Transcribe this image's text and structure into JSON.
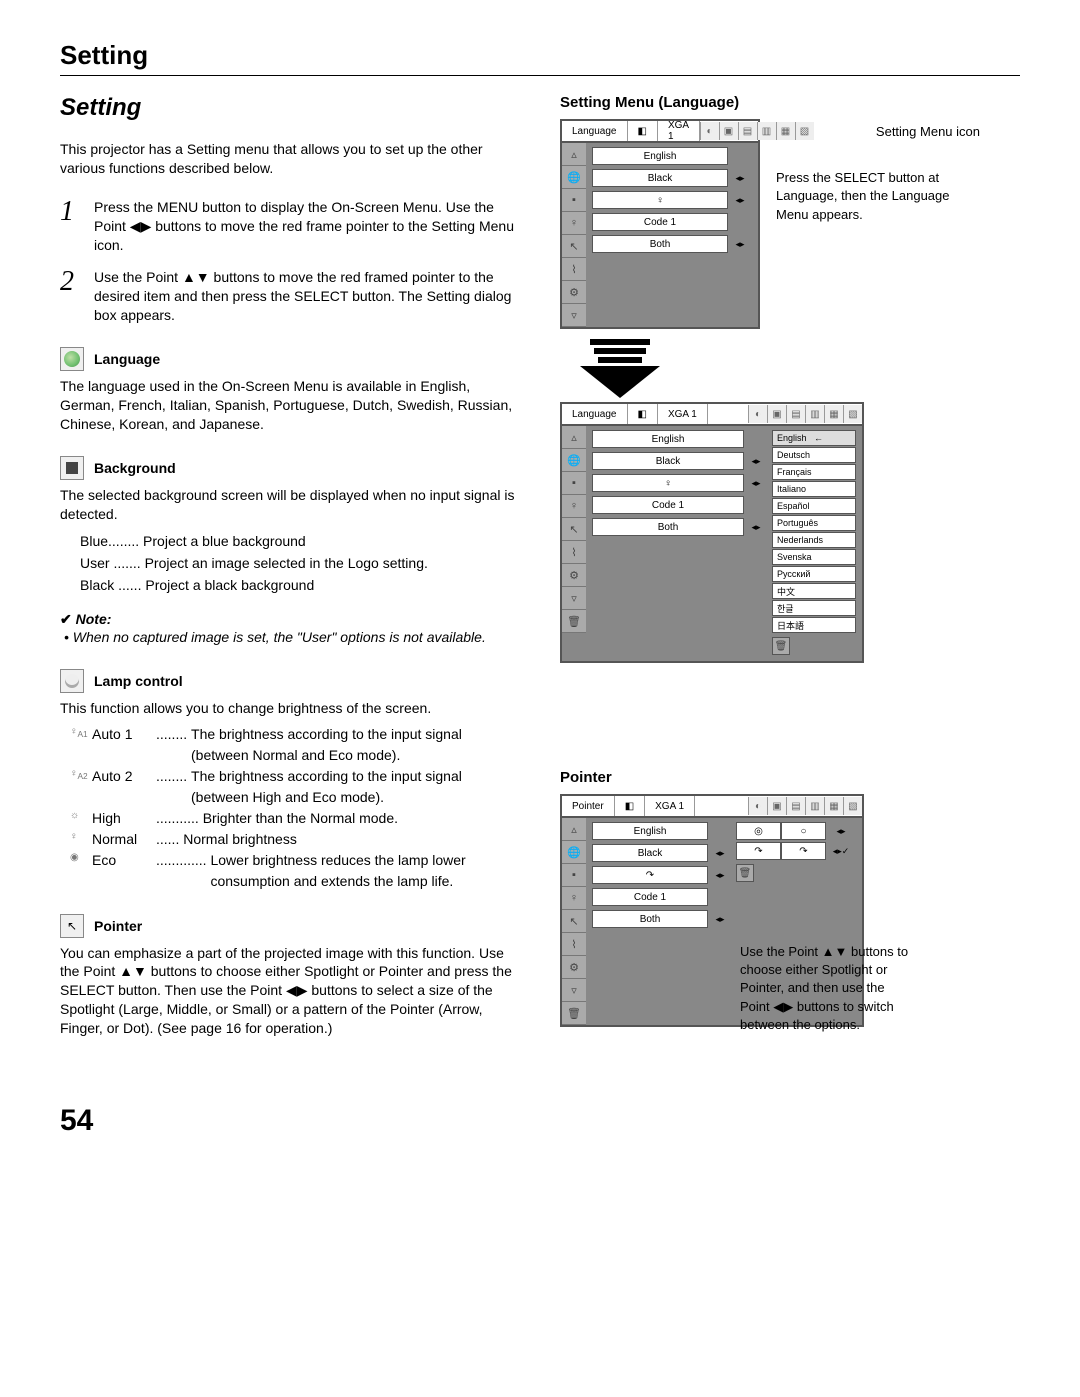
{
  "header": "Setting",
  "subtitle": "Setting",
  "intro": "This projector has a Setting menu that allows you to set up the other various functions described below.",
  "steps": [
    "Press the MENU button to display the On-Screen Menu. Use the Point ◀▶ buttons to move the red frame pointer to the Setting Menu icon.",
    "Use the Point ▲▼ buttons to move the red framed pointer to the desired item and then press the SELECT button. The Setting dialog box appears."
  ],
  "language": {
    "title": "Language",
    "text": "The language used in the On-Screen Menu is available in English, German, French, Italian, Spanish, Portuguese, Dutch, Swedish, Russian, Chinese, Korean, and Japanese."
  },
  "background": {
    "title": "Background",
    "text": "The selected background screen will be displayed when no input signal is detected.",
    "defs": [
      {
        "k": "Blue",
        "dots": "........",
        "v": "Project a blue background"
      },
      {
        "k": "User",
        "dots": " .......",
        "v": "Project an image selected in the Logo setting."
      },
      {
        "k": "Black",
        "dots": " ......",
        "v": "Project a black background"
      }
    ]
  },
  "note": {
    "title": "Note:",
    "text": "• When no captured image is set, the \"User\" options is not available."
  },
  "lamp": {
    "title": "Lamp control",
    "text": "This function allows you to change brightness of the screen.",
    "items": [
      {
        "ico": "A1",
        "label": "Auto 1",
        "dots": " ........",
        "desc": "The brightness according to the input signal (between Normal and Eco mode)."
      },
      {
        "ico": "A2",
        "label": "Auto 2",
        "dots": " ........",
        "desc": "The brightness according to the input signal (between High and Eco mode)."
      },
      {
        "ico": "☼",
        "label": "High",
        "dots": " ...........",
        "desc": "Brighter than the Normal mode."
      },
      {
        "ico": "♀",
        "label": "Normal",
        "dots": "  ......",
        "desc": "Normal brightness"
      },
      {
        "ico": "◉",
        "label": "Eco",
        "dots": ".............",
        "desc": "Lower brightness reduces the lamp lower consumption and extends the lamp life."
      }
    ]
  },
  "pointer": {
    "title": "Pointer",
    "text": "You can emphasize a part of the projected image with this function. Use the Point ▲▼ buttons to choose either Spotlight or Pointer and press the SELECT button. Then use the Point ◀▶ buttons to select a size of the Spotlight (Large, Middle, or Small) or a pattern of the Pointer (Arrow, Finger, or Dot). (See page 16 for operation.)"
  },
  "right": {
    "langTitle": "Setting Menu (Language)",
    "annot1": "Setting Menu icon",
    "annot2": "Press the SELECT button at Language, then the Language Menu appears.",
    "ptrTitle": "Pointer",
    "annot3": "Use the Point ▲▼ buttons to choose either Spotlight or Pointer, and then use the Point ◀▶ buttons to switch between the options."
  },
  "menu": {
    "topLabel1": "Language",
    "topLabel2": "XGA 1",
    "rows": [
      "English",
      "Black",
      "♀",
      "Code 1",
      "Both"
    ],
    "ptrTop": "Pointer",
    "ptrRows": [
      "English",
      "Black",
      "↷",
      "Code 1",
      "Both"
    ]
  },
  "langList": [
    "English",
    "Deutsch",
    "Français",
    "Italiano",
    "Español",
    "Português",
    "Nederlands",
    "Svenska",
    "Русский",
    "中文",
    "한글",
    "日本語"
  ],
  "pageNum": "54"
}
